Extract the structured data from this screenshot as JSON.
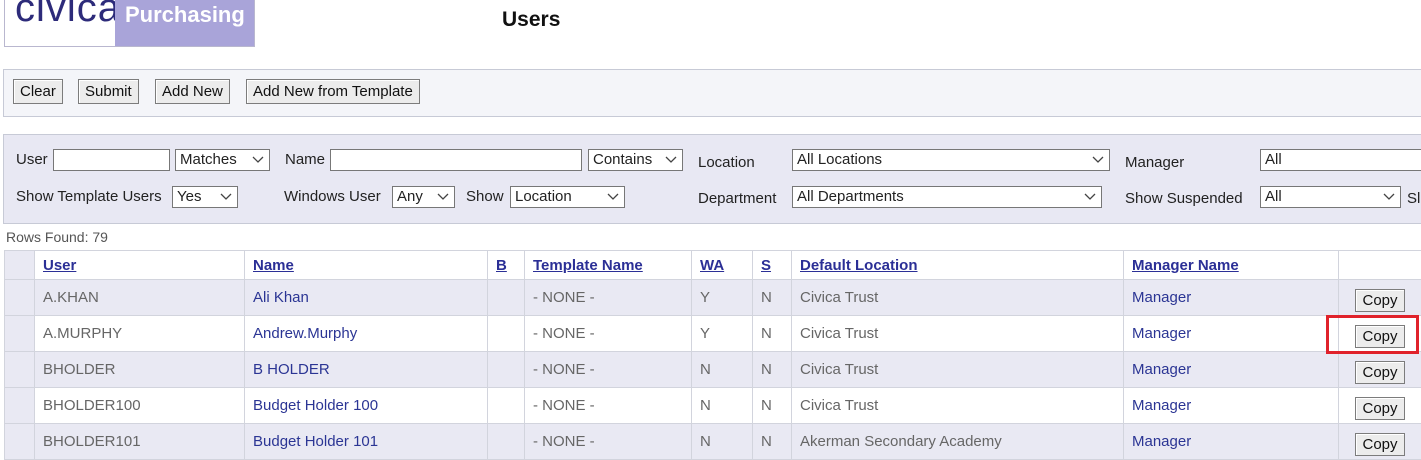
{
  "header": {
    "logo_brand": "civica",
    "logo_product": "Purchasing",
    "page_title": "Users"
  },
  "toolbar": {
    "clear_label": "Clear",
    "submit_label": "Submit",
    "add_new_label": "Add New",
    "add_template_label": "Add New from Template"
  },
  "filters": {
    "user_label": "User",
    "user_value": "",
    "user_match": "Matches",
    "name_label": "Name",
    "name_value": "",
    "name_match": "Contains",
    "location_label": "Location",
    "location_value": "All Locations",
    "manager_label": "Manager",
    "manager_value": "All",
    "template_users_label": "Show Template Users",
    "template_users_value": "Yes",
    "windows_user_label": "Windows User",
    "windows_user_value": "Any",
    "show_label": "Show",
    "show_value": "Location",
    "department_label": "Department",
    "department_value": "All Departments",
    "suspended_label": "Show Suspended",
    "suspended_value": "All",
    "cut_off_label": "Sl"
  },
  "rows_found": "Rows Found: 79",
  "table": {
    "columns": [
      "User",
      "Name",
      "B",
      "Template Name",
      "WA",
      "S",
      "Default Location",
      "Manager Name"
    ],
    "rows": [
      {
        "user": "A.KHAN",
        "name": "Ali Khan",
        "b": "",
        "template": "- NONE -",
        "wa": "Y",
        "s": "N",
        "location": "Civica Trust",
        "manager": "Manager",
        "action": "Copy"
      },
      {
        "user": "A.MURPHY",
        "name": "Andrew.Murphy",
        "b": "",
        "template": "- NONE -",
        "wa": "Y",
        "s": "N",
        "location": "Civica Trust",
        "manager": "Manager",
        "action": "Copy"
      },
      {
        "user": "BHOLDER",
        "name": "B HOLDER",
        "b": "",
        "template": "- NONE -",
        "wa": "N",
        "s": "N",
        "location": "Civica Trust",
        "manager": "Manager",
        "action": "Copy"
      },
      {
        "user": "BHOLDER100",
        "name": "Budget Holder 100",
        "b": "",
        "template": "- NONE -",
        "wa": "N",
        "s": "N",
        "location": "Civica Trust",
        "manager": "Manager",
        "action": "Copy"
      },
      {
        "user": "BHOLDER101",
        "name": "Budget Holder 101",
        "b": "",
        "template": "- NONE -",
        "wa": "N",
        "s": "N",
        "location": "Akerman Secondary Academy",
        "manager": "Manager",
        "action": "Copy"
      }
    ]
  },
  "colors": {
    "brand_purple": "#a9a4d9",
    "brand_text": "#2d2b7a",
    "link_blue": "#2b3594",
    "row_alt": "#e9e9f3",
    "highlight_red": "#e0222b"
  },
  "icons": {
    "dropdown": "chevron-down-icon"
  }
}
